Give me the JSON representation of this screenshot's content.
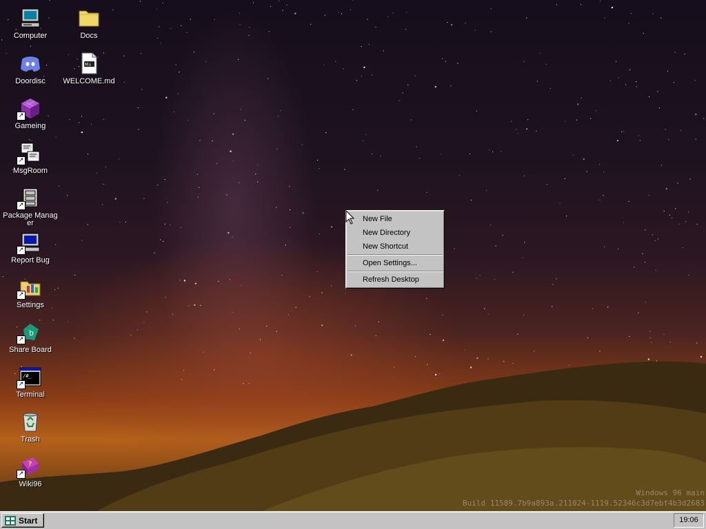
{
  "desktop": {
    "icons_col1": [
      {
        "label": "Computer",
        "icon": "computer-icon",
        "shortcut": false
      },
      {
        "label": "Doordisc",
        "icon": "discord-icon",
        "shortcut": false
      },
      {
        "label": "Gameing",
        "icon": "game-cube-icon",
        "shortcut": true
      },
      {
        "label": "MsgRoom",
        "icon": "chat-computers-icon",
        "shortcut": true
      },
      {
        "label": "Package Manager",
        "icon": "package-manager-icon",
        "shortcut": true
      },
      {
        "label": "Report Bug",
        "icon": "report-bug-icon",
        "shortcut": true
      },
      {
        "label": "Settings",
        "icon": "settings-folder-icon",
        "shortcut": true
      },
      {
        "label": "Share Board",
        "icon": "share-board-icon",
        "shortcut": true
      },
      {
        "label": "Terminal",
        "icon": "terminal-icon",
        "shortcut": true
      },
      {
        "label": "Trash",
        "icon": "recycle-bin-icon",
        "shortcut": false
      },
      {
        "label": "Wiki96",
        "icon": "help-book-icon",
        "shortcut": true
      }
    ],
    "icons_col2": [
      {
        "label": "Docs",
        "icon": "folder-icon",
        "shortcut": false
      },
      {
        "label": "WELCOME.md",
        "icon": "markdown-file-icon",
        "shortcut": false
      }
    ]
  },
  "context_menu": {
    "items": [
      "New File",
      "New Directory",
      "New Shortcut",
      "Open Settings...",
      "Refresh Desktop"
    ]
  },
  "build_info": {
    "line1": "Windows 96 main",
    "line2": "Build 11589.7b9a893a.211024-1119.52346c3d7ebf4b3d2683"
  },
  "taskbar": {
    "start_label": "Start",
    "clock": "19:06"
  },
  "colors": {
    "taskbar_bg": "#c3c3c3",
    "menu_bg": "#c3c3c3",
    "label_text": "#ffffff"
  }
}
